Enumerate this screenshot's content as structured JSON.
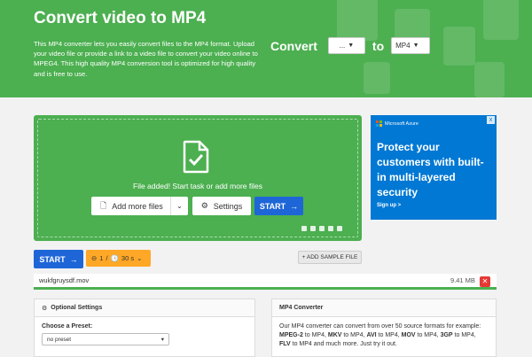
{
  "hero": {
    "title": "Convert video to MP4",
    "description": "This MP4 converter lets you easily convert files to the MP4 format. Upload your video file or provide a link to a video file to convert your video online to MPEG4. This high quality MP4 conversion tool is optimized for high quality and is free to use.",
    "convert_label": "Convert",
    "from_value": "...",
    "to_label": "to",
    "to_value": "MP4"
  },
  "dropzone": {
    "message": "File added! Start task or add more files",
    "add_files_label": "Add more files",
    "settings_label": "Settings",
    "start_label": "START"
  },
  "ad": {
    "brand": "Microsoft Azure",
    "close": "x",
    "headline": "Protect your customers with built-in multi-layered security",
    "cta": "Sign up >"
  },
  "taskbar": {
    "start_label": "START",
    "task_count": "1",
    "task_sep": "/",
    "task_time": "30 s",
    "sample_label": "+ ADD SAMPLE FILE"
  },
  "file": {
    "name": "wukfgruysdf.mov",
    "size": "9.41 MB",
    "delete": "✕"
  },
  "optional_settings": {
    "title": "Optional Settings",
    "preset_label": "Choose a Preset:",
    "preset_value": "no preset"
  },
  "info": {
    "title": "MP4 Converter",
    "intro": "Our MP4 converter can convert from over 50 source formats for example:",
    "f1": "MPEG-2",
    "f2": "MKV",
    "f3": "AVI",
    "f4": "MOV",
    "f5": "3GP",
    "f6": "FLV",
    "to_mp4": " to MP4, ",
    "to_mp4_last": " to MP4, ",
    "outro": " to MP4 and much more. Just try it out."
  },
  "colors": {
    "brand_green": "#4caf50",
    "start_blue": "#1e66d8",
    "task_orange": "#ffa726",
    "ad_blue": "#0078d4",
    "delete_red": "#e53935"
  }
}
